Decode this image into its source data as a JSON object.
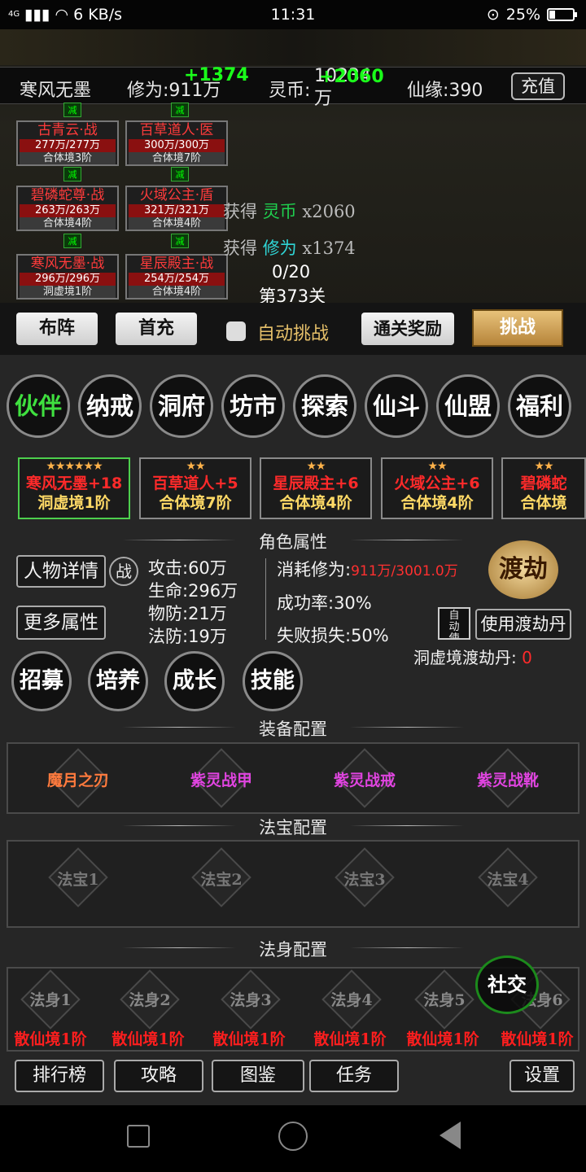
{
  "status_bar": {
    "network": "4G",
    "speed": "6 KB/s",
    "time": "11:31",
    "battery": "25%",
    "battery_level": 0.25
  },
  "resources": {
    "player_name": "寒风无墨",
    "cultivation_label": "修为:911万",
    "cultivation_gain": "+1374",
    "spirit_coin_label": "灵币:",
    "spirit_coin_value": "10234",
    "spirit_coin_unit": "万",
    "spirit_coin_gain": "+2060",
    "fate_label": "仙缘:390",
    "recharge_button": "充值"
  },
  "battle": {
    "units": [
      {
        "name": "古青云·战",
        "hp": "277万/277万",
        "realm": "合体境3阶"
      },
      {
        "name": "百草道人·医",
        "hp": "300万/300万",
        "realm": "合体境7阶"
      },
      {
        "name": "碧磷蛇尊·战",
        "hp": "263万/263万",
        "realm": "合体境4阶"
      },
      {
        "name": "火域公主·盾",
        "hp": "321万/321万",
        "realm": "合体境4阶"
      },
      {
        "name": "寒风无墨·战",
        "hp": "296万/296万",
        "realm": "洞虚境1阶"
      },
      {
        "name": "星辰殿主·战",
        "hp": "254万/254万",
        "realm": "合体境4阶"
      }
    ],
    "reduce_label": "减",
    "gain_coin": {
      "prefix": "获得",
      "item": "灵币",
      "amount": "x2060"
    },
    "gain_cultivation": {
      "prefix": "获得",
      "item": "修为",
      "amount": "x1374"
    },
    "progress": "0/20",
    "stage": "第373关"
  },
  "actions": {
    "formation": "布阵",
    "first_recharge": "首充",
    "auto_challenge": "自动挑战",
    "clear_reward": "通关奖励",
    "challenge": "挑战"
  },
  "main_tabs": [
    "伙伴",
    "纳戒",
    "洞府",
    "坊市",
    "探索",
    "仙斗",
    "仙盟",
    "福利"
  ],
  "partners": [
    {
      "stars": "★★★★★★",
      "name": "寒风无墨+18",
      "realm": "洞虚境1阶"
    },
    {
      "stars": "★★",
      "name": "百草道人+5",
      "realm": "合体境7阶"
    },
    {
      "stars": "★★",
      "name": "星辰殿主+6",
      "realm": "合体境4阶"
    },
    {
      "stars": "★★",
      "name": "火域公主+6",
      "realm": "合体境4阶"
    },
    {
      "stars": "★★",
      "name": "碧磷蛇",
      "realm": "合体境"
    }
  ],
  "attributes": {
    "section_title": "角色属性",
    "detail_button": "人物详情",
    "war_badge": "战",
    "more_button": "更多属性",
    "attack": "攻击:60万",
    "life": "生命:296万",
    "phys_def": "物防:21万",
    "magic_def": "法防:19万",
    "cost_label": "消耗修为:",
    "cost_value": "911万/3001.0万",
    "success_rate": "成功率:30%",
    "fail_loss": "失败损失:50%",
    "tribulation_badge": "渡劫",
    "auto_use": "自动使用",
    "use_pill": "使用渡劫丹",
    "pill_label": "洞虚境渡劫丹:",
    "pill_count": "0"
  },
  "sub_buttons": [
    "招募",
    "培养",
    "成长",
    "技能"
  ],
  "equipment": {
    "section_title": "装备配置",
    "items": [
      {
        "name": "魔月之刃",
        "color": "#ff7a3d"
      },
      {
        "name": "紫灵战甲",
        "color": "#e044e0"
      },
      {
        "name": "紫灵战戒",
        "color": "#e044e0"
      },
      {
        "name": "紫灵战靴",
        "color": "#e044e0"
      }
    ]
  },
  "treasures": {
    "section_title": "法宝配置",
    "items": [
      "法宝1",
      "法宝2",
      "法宝3",
      "法宝4"
    ]
  },
  "bodies": {
    "section_title": "法身配置",
    "items": [
      {
        "name": "法身1",
        "realm": "散仙境1阶"
      },
      {
        "name": "法身2",
        "realm": "散仙境1阶"
      },
      {
        "name": "法身3",
        "realm": "散仙境1阶"
      },
      {
        "name": "法身4",
        "realm": "散仙境1阶"
      },
      {
        "name": "法身5",
        "realm": "散仙境1阶"
      },
      {
        "name": "法身6",
        "realm": "散仙境1阶"
      }
    ],
    "social_button": "社交"
  },
  "bottom_buttons": {
    "ranking": "排行榜",
    "guide": "攻略",
    "atlas": "图鉴",
    "tasks": "任务",
    "settings": "设置"
  },
  "colors": {
    "accent_green": "#1aff1a",
    "danger_red": "#ff2a2a",
    "rank_gold": "#ffd966"
  }
}
